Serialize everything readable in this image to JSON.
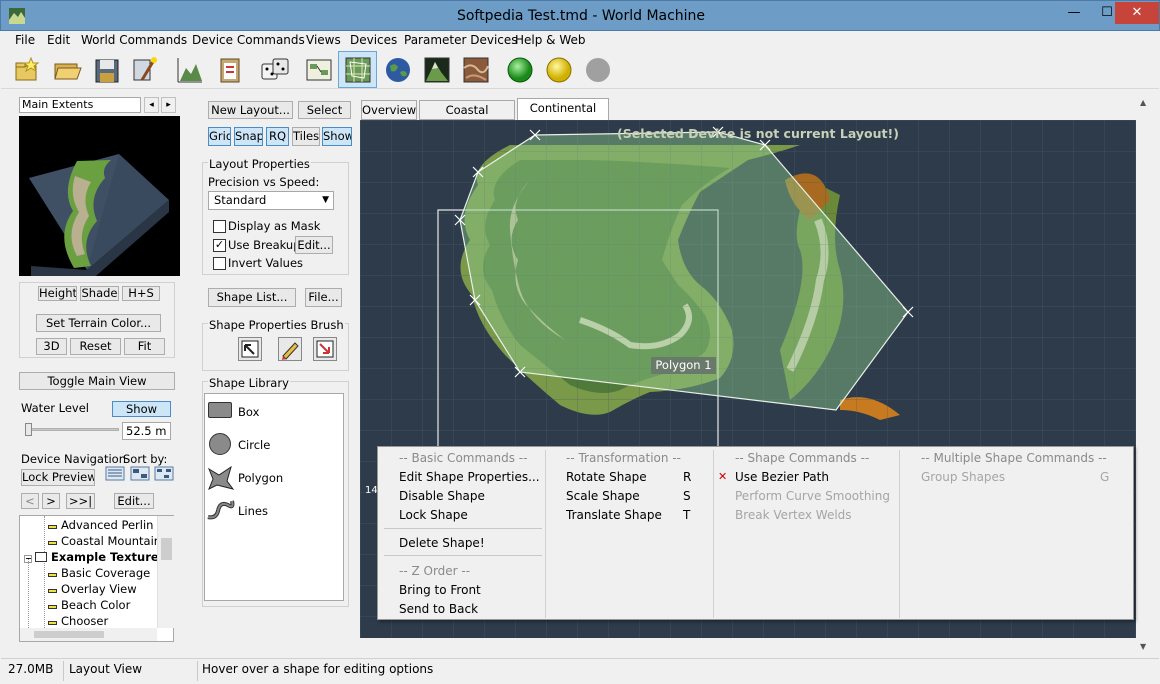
{
  "window": {
    "title": "Softpedia Test.tmd - World Machine",
    "minimize": "—",
    "maximize": "☐",
    "close": "✕"
  },
  "menubar": [
    "File",
    "Edit",
    "World Commands",
    "Device Commands",
    "Views",
    "Devices",
    "Parameter Devices",
    "Help & Web"
  ],
  "toolbar_icons": [
    "new-folder-icon",
    "open-folder-icon",
    "save-icon",
    "wizard-icon",
    "terrain-chart-icon",
    "clipboard-icon",
    "dice-icon",
    "device-view-icon",
    "layout-view-icon",
    "globe-icon",
    "terrain-render-icon",
    "texture-icon",
    "build-green-icon",
    "build-yellow-icon",
    "build-gray-icon"
  ],
  "preview": {
    "selector": "Main Extents",
    "buttons": {
      "height": "Height",
      "shade": "Shade",
      "hs": "H+S",
      "terrain_color": "Set Terrain Color...",
      "view3d": "3D",
      "reset": "Reset",
      "fit": "Fit",
      "toggle": "Toggle Main View"
    },
    "water_level_label": "Water Level",
    "water_show": "Show",
    "water_value": "52.5 m"
  },
  "device_nav": {
    "label": "Device Navigation",
    "sort_label": "Sort by:",
    "lock_preview": "Lock Preview",
    "prev": "<",
    "next": ">",
    "last": ">>|",
    "edit": "Edit..."
  },
  "tree": [
    {
      "label": "Advanced Perlin",
      "bold": false
    },
    {
      "label": "Coastal Mountains",
      "bold": false
    },
    {
      "label": "Example Texture",
      "bold": true
    },
    {
      "label": "Basic Coverage",
      "bold": false
    },
    {
      "label": "Overlay View",
      "bold": false
    },
    {
      "label": "Beach Color",
      "bold": false
    },
    {
      "label": "Chooser",
      "bold": false
    }
  ],
  "layout_panel": {
    "new_layout": "New Layout...",
    "select": "Select",
    "toggles": [
      "Grid",
      "Snap",
      "RQ",
      "Tiles",
      "Show"
    ],
    "props_title": "Layout Properties",
    "precision_label": "Precision vs Speed:",
    "precision_value": "Standard",
    "display_as_mask": "Display as Mask",
    "use_breakup": "Use Breakup",
    "breakup_edit": "Edit...",
    "invert_values": "Invert Values",
    "shape_list": "Shape List...",
    "file": "File...",
    "brush_title": "Shape Properties Brush",
    "library_title": "Shape Library",
    "library": [
      "Box",
      "Circle",
      "Polygon",
      "Lines"
    ]
  },
  "tabs": [
    "Overview",
    "Coastal Mountains",
    "Continental Shelf"
  ],
  "active_tab": "Continental Shelf",
  "canvas": {
    "warning": "(Selected Device is not current Layout!)",
    "polygon_label": "Polygon 1",
    "edge_marker": "14"
  },
  "context_menu": {
    "basic_header": "-- Basic Commands --",
    "basic": [
      "Edit Shape Properties...",
      "Disable Shape",
      "Lock Shape"
    ],
    "delete": "Delete Shape!",
    "z_header": "-- Z Order --",
    "z": [
      "Bring to Front",
      "Send to Back"
    ],
    "transform_header": "-- Transformation --",
    "transform": [
      {
        "label": "Rotate Shape",
        "key": "R"
      },
      {
        "label": "Scale Shape",
        "key": "S"
      },
      {
        "label": "Translate Shape",
        "key": "T"
      }
    ],
    "shape_header": "-- Shape Commands --",
    "shape": [
      {
        "label": "Use Bezier Path",
        "enabled": true,
        "checked": true
      },
      {
        "label": "Perform Curve Smoothing",
        "enabled": false
      },
      {
        "label": "Break Vertex Welds",
        "enabled": false
      }
    ],
    "multi_header": "-- Multiple Shape Commands --",
    "multi": [
      {
        "label": "Group Shapes",
        "key": "G"
      }
    ],
    "check_mark": "✕"
  },
  "statusbar": {
    "memory": "27.0MB",
    "view": "Layout View",
    "hint": "Hover over a shape for editing options"
  },
  "colors": {
    "titlebar": "#6d9cc7",
    "canvas_bg": "#2d3b4a",
    "polygon_fill": "#8cc88c",
    "accent_blue": "#cde6f7"
  }
}
